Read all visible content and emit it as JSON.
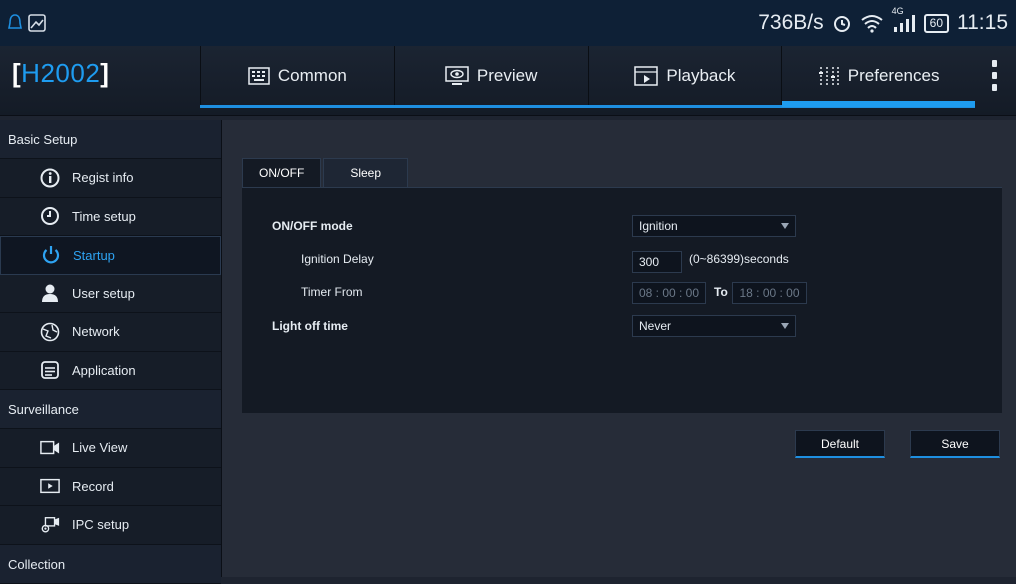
{
  "status": {
    "net_speed": "736B/s",
    "signal_label": "4G",
    "battery": "60",
    "time": "11:15"
  },
  "brand": {
    "name": "H2002"
  },
  "nav": {
    "tabs": [
      {
        "label": "Common"
      },
      {
        "label": "Preview"
      },
      {
        "label": "Playback"
      },
      {
        "label": "Preferences"
      }
    ]
  },
  "sidebar": {
    "sections": [
      {
        "title": "Basic Setup"
      },
      {
        "title": "Surveillance"
      },
      {
        "title": "Collection"
      }
    ],
    "items": [
      {
        "label": "Regist info"
      },
      {
        "label": "Time setup"
      },
      {
        "label": "Startup"
      },
      {
        "label": "User setup"
      },
      {
        "label": "Network"
      },
      {
        "label": "Application"
      },
      {
        "label": "Live View"
      },
      {
        "label": "Record"
      },
      {
        "label": "IPC setup"
      }
    ]
  },
  "content": {
    "tabs": [
      {
        "label": "ON/OFF"
      },
      {
        "label": "Sleep"
      }
    ],
    "onoff_mode_label": "ON/OFF mode",
    "onoff_mode_value": "Ignition",
    "ignition_delay_label": "Ignition Delay",
    "ignition_delay_value": "300",
    "ignition_delay_hint": "(0~86399)seconds",
    "timer_from_label": "Timer From",
    "timer_from_value": "08 : 00 : 00",
    "timer_to_label": "To",
    "timer_to_value": "18 : 00 : 00",
    "light_off_label": "Light off time",
    "light_off_value": "Never",
    "default_button": "Default",
    "save_button": "Save"
  },
  "colors": {
    "accent": "#1e9cf0",
    "background": "#262c38",
    "panel": "#141a24"
  }
}
